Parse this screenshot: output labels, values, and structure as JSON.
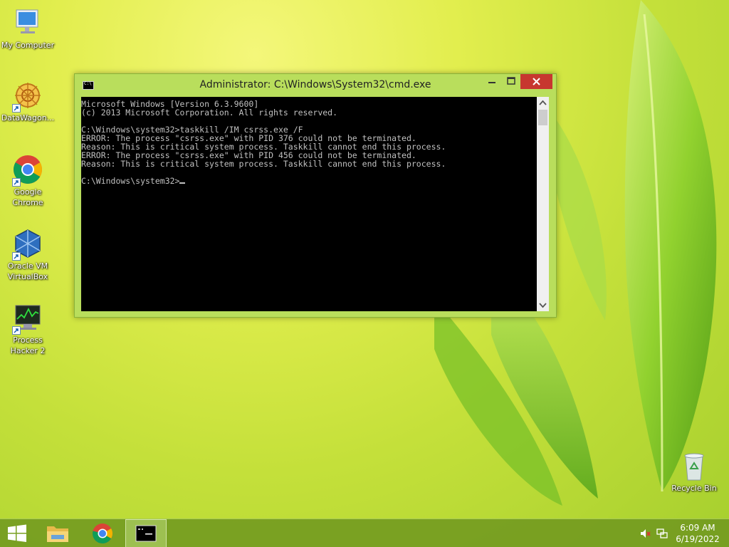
{
  "desktop": {
    "icons": [
      {
        "label": "My Computer"
      },
      {
        "label": "DataWagon..."
      },
      {
        "label": "Google Chrome"
      },
      {
        "label": "Oracle VM VirtualBox"
      },
      {
        "label": "Process Hacker 2"
      },
      {
        "label": "Recycle Bin"
      }
    ]
  },
  "cmd_window": {
    "title": "Administrator: C:\\Windows\\System32\\cmd.exe",
    "sys_icon_text": "C:\\",
    "lines": [
      "Microsoft Windows [Version 6.3.9600]",
      "(c) 2013 Microsoft Corporation. All rights reserved.",
      "",
      "C:\\Windows\\system32>taskkill /IM csrss.exe /F",
      "ERROR: The process \"csrss.exe\" with PID 376 could not be terminated.",
      "Reason: This is critical system process. Taskkill cannot end this process.",
      "ERROR: The process \"csrss.exe\" with PID 456 could not be terminated.",
      "Reason: This is critical system process. Taskkill cannot end this process.",
      ""
    ],
    "prompt": "C:\\Windows\\system32>"
  },
  "taskbar": {
    "items": [
      "start-icon",
      "file-explorer-icon",
      "chrome-icon",
      "cmd-icon"
    ],
    "clock_time": "6:09 AM",
    "clock_date": "6/19/2022"
  },
  "colors": {
    "console_bg": "#000000",
    "console_fg": "#c0c0c0",
    "close_button": "#c7372f",
    "window_frame": "#b9de5c"
  }
}
